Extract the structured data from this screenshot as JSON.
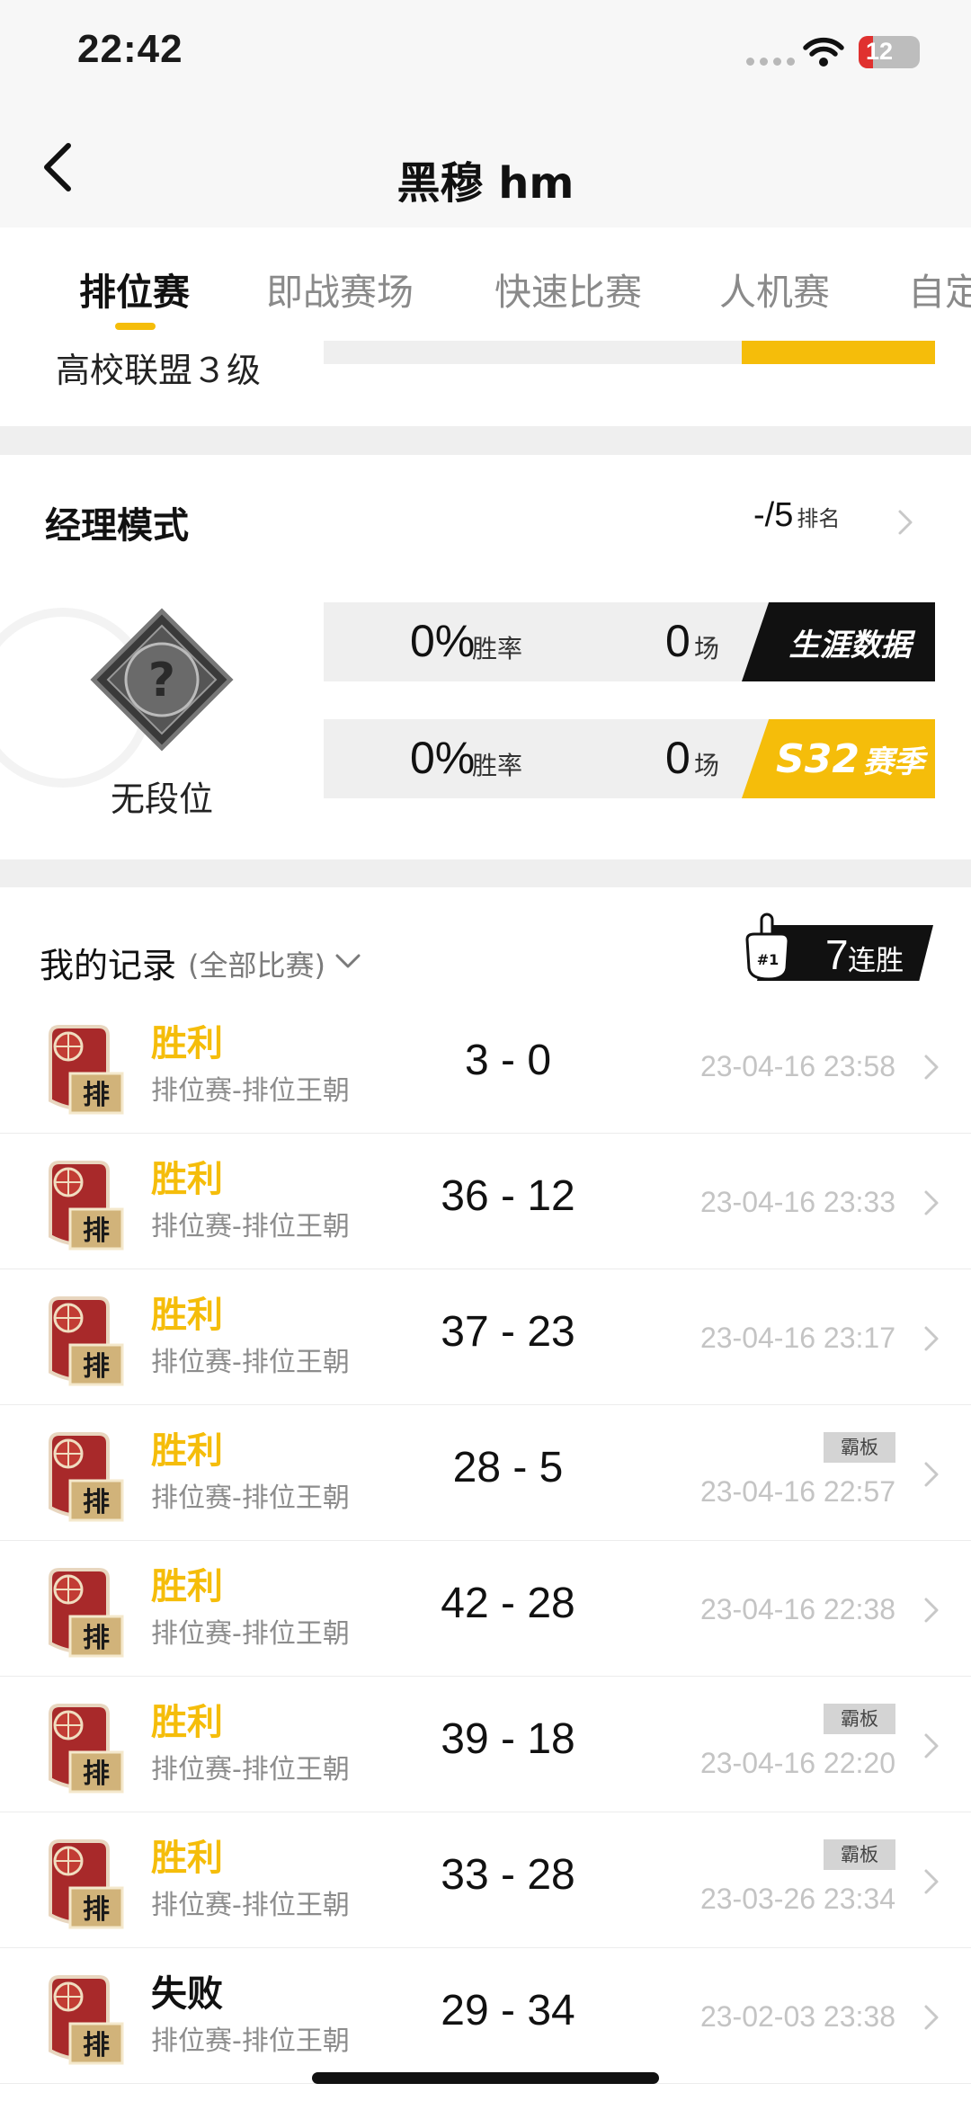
{
  "status_bar": {
    "time": "22:42",
    "battery": "12"
  },
  "nav": {
    "title": "黑穆 hm"
  },
  "tabs": [
    {
      "label": "排位赛",
      "active": true
    },
    {
      "label": "即战赛场",
      "active": false
    },
    {
      "label": "快速比赛",
      "active": false
    },
    {
      "label": "人机赛",
      "active": false
    },
    {
      "label": "自定",
      "active": false
    }
  ],
  "peek": {
    "label": "高校联盟３级"
  },
  "manager": {
    "title": "经理模式",
    "rank_value": "-/5",
    "rank_label": "排名",
    "tier": "无段位",
    "career": {
      "win_rate": "0%",
      "win_rate_label": "胜率",
      "games": "0",
      "games_label": "场",
      "tag": "生涯数据"
    },
    "season": {
      "win_rate": "0%",
      "win_rate_label": "胜率",
      "games": "0",
      "games_label": "场",
      "season_code": "S32",
      "season_label": "赛季"
    }
  },
  "records": {
    "title": "我的记录",
    "filter": "(全部比赛)",
    "streak_value": "7",
    "streak_label": "连胜",
    "rows": [
      {
        "result": "胜利",
        "mode": "排位赛-排位王朝",
        "score": "3 - 0",
        "date": "23-04-16 23:58",
        "badge": ""
      },
      {
        "result": "胜利",
        "mode": "排位赛-排位王朝",
        "score": "36 - 12",
        "date": "23-04-16 23:33",
        "badge": ""
      },
      {
        "result": "胜利",
        "mode": "排位赛-排位王朝",
        "score": "37 - 23",
        "date": "23-04-16 23:17",
        "badge": ""
      },
      {
        "result": "胜利",
        "mode": "排位赛-排位王朝",
        "score": "28 - 5",
        "date": "23-04-16 22:57",
        "badge": "霸板"
      },
      {
        "result": "胜利",
        "mode": "排位赛-排位王朝",
        "score": "42 - 28",
        "date": "23-04-16 22:38",
        "badge": ""
      },
      {
        "result": "胜利",
        "mode": "排位赛-排位王朝",
        "score": "39 - 18",
        "date": "23-04-16 22:20",
        "badge": "霸板"
      },
      {
        "result": "胜利",
        "mode": "排位赛-排位王朝",
        "score": "33 - 28",
        "date": "23-03-26 23:34",
        "badge": "霸板"
      },
      {
        "result": "失败",
        "mode": "排位赛-排位王朝",
        "score": "29 - 34",
        "date": "23-02-03 23:38",
        "badge": ""
      }
    ]
  },
  "icons": {
    "back": "chevron-left-icon",
    "rank_arrow": "chevron-right-icon",
    "filter": "chevron-down-icon",
    "streak": "foam-finger-icon",
    "row": "ranked-basketball-icon"
  },
  "colors": {
    "accent": "#f5bd0a",
    "dark": "#111111",
    "muted": "#8c8c8c",
    "separator": "#efefef"
  }
}
